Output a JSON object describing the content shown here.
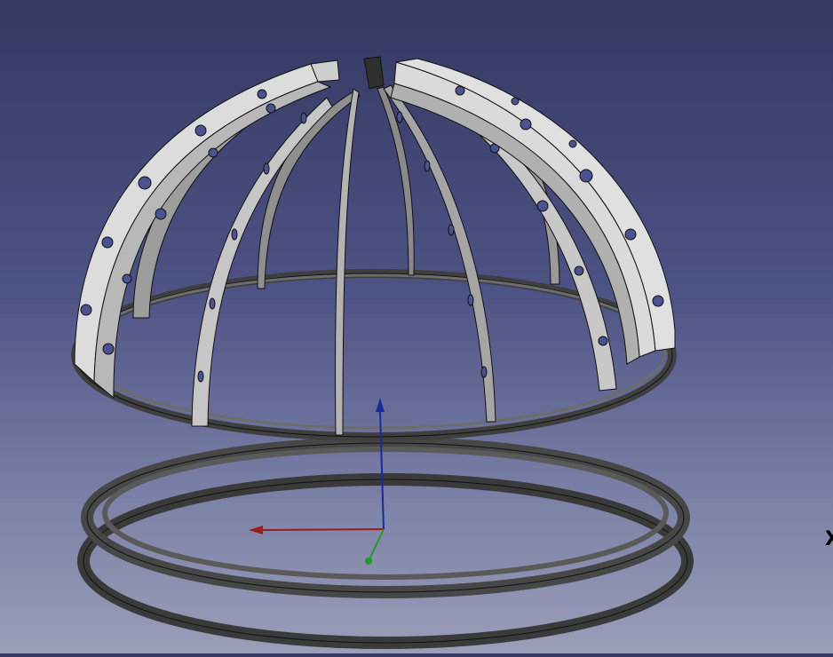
{
  "viewport": {
    "background_top": "#343862",
    "background_bottom": "#9a9eb8"
  },
  "axes": {
    "x_label": "X",
    "x_color": "#9c1a1a",
    "y_color": "#1f9a2a",
    "z_color": "#1a2a9c"
  },
  "model": {
    "rib_face": "#c4c4c4",
    "rib_side": "#8a8a8a",
    "ring_color": "#474747",
    "edge_color": "#111111"
  }
}
